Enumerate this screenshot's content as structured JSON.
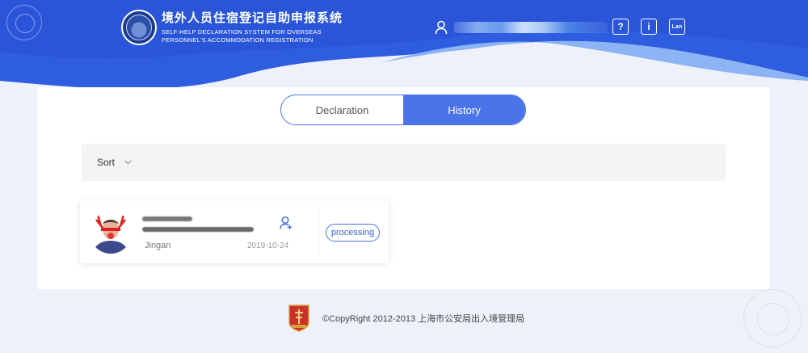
{
  "header": {
    "title_cn": "境外人员住宿登记自助申报系统",
    "title_en_line1": "SELF-HELP DECLARATION SYSTEM FOR OVERSEAS",
    "title_en_line2": "PERSONNEL'S ACCOMMODATION REGISTRATION",
    "username": "",
    "help_label": "?",
    "info_label": "i",
    "lang_label": "Lan"
  },
  "tabs": {
    "declaration_label": "Declaration",
    "history_label": "History",
    "active": "History"
  },
  "sort": {
    "label": "Sort"
  },
  "records": [
    {
      "name": "",
      "district": "Jingan",
      "date": "2019-10-24",
      "status": "processing"
    }
  ],
  "footer": {
    "copyright": "©CopyRight 2012-2013 上海市公安局出入境管理局"
  },
  "colors": {
    "header_blue": "#2f5de0",
    "accent": "#4a74e8",
    "wave_light": "#8cb4f5",
    "page_bg": "#eef1f9"
  },
  "icons": {
    "user": "user-icon",
    "help": "help-icon",
    "info": "info-icon",
    "language": "language-icon",
    "sort_chevron": "chevron-down-icon",
    "record_person": "person-add-icon"
  }
}
